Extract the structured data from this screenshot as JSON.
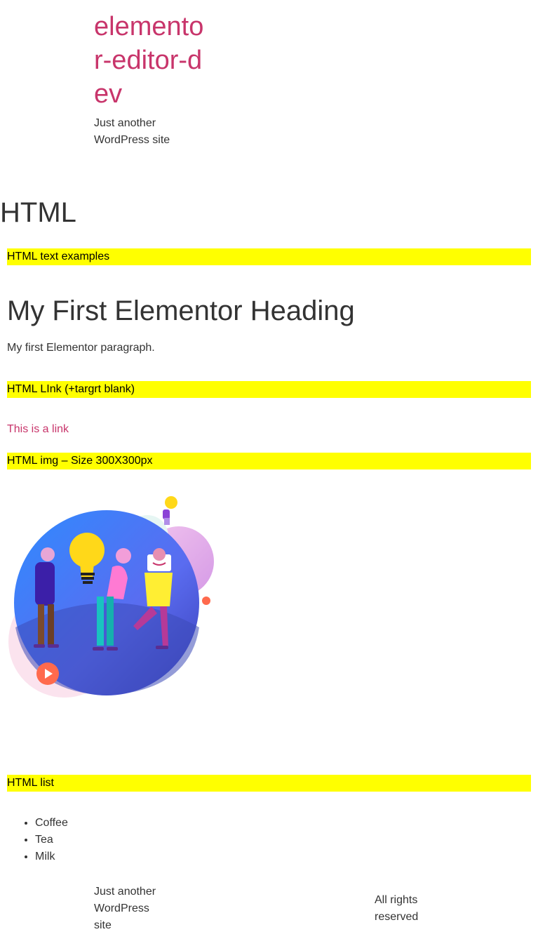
{
  "header": {
    "site_title": "elementor-editor-dev",
    "tagline": "Just another WordPress site"
  },
  "page": {
    "title": "HTML"
  },
  "sections": {
    "text_examples": "HTML text examples",
    "link_section": "HTML LInk (+targrt blank)",
    "img_section": "HTML img – Size 300X300px",
    "list_section": "HTML list"
  },
  "content": {
    "heading": "My First Elementor Heading",
    "paragraph": "My first Elementor paragraph.",
    "link_text": "This is a link",
    "image_icon": "people-lightbulb-illustration",
    "list_items": [
      "Coffee",
      "Tea",
      "Milk"
    ]
  },
  "footer": {
    "tagline": "Just another WordPress site",
    "rights": "All rights reserved"
  },
  "colors": {
    "accent": "#c8356b",
    "highlight": "#ffff00",
    "text": "#333333"
  }
}
